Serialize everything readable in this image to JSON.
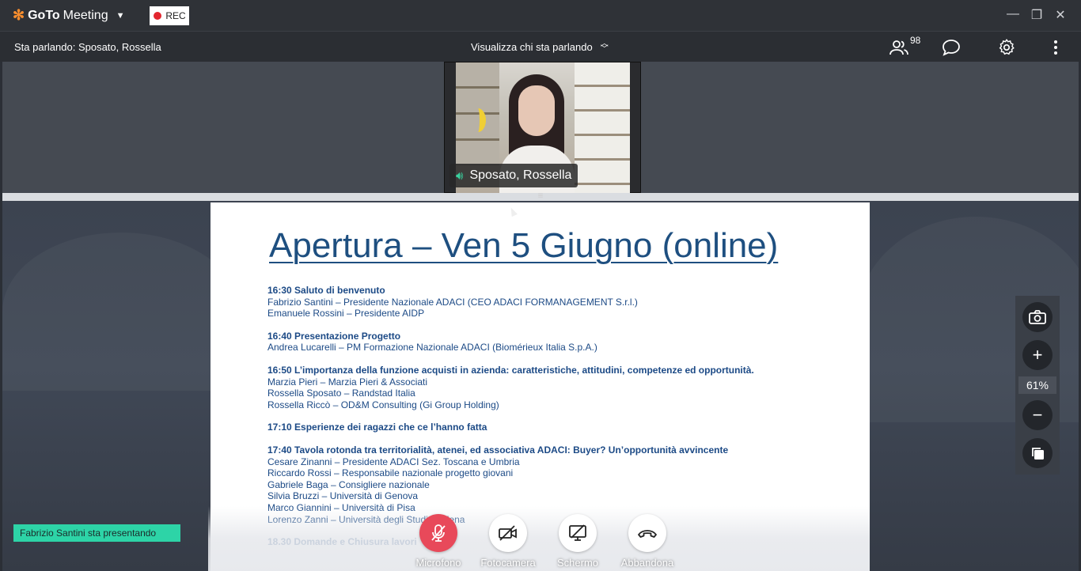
{
  "app": {
    "logo_brand": "GoTo",
    "logo_product": "Meeting",
    "rec_label": "REC"
  },
  "window_controls": {
    "minimize_icon": "minimize-icon",
    "restore_icon": "restore-icon",
    "close_icon": "close-icon"
  },
  "toolbar": {
    "speaking_label": "Sta parlando: Sposato,  Rossella",
    "view_selector_label": "Visualizza chi sta parlando",
    "attendee_count": "98"
  },
  "video": {
    "participant_name": "Sposato,  Rossella"
  },
  "slide": {
    "title": "Apertura – Ven 5 Giugno (online)",
    "agenda": [
      {
        "heading": "16:30 Saluto di benvenuto",
        "lines": [
          "Fabrizio Santini – Presidente Nazionale ADACI (CEO ADACI FORMANAGEMENT S.r.l.)",
          "Emanuele Rossini – Presidente AIDP"
        ]
      },
      {
        "heading": "16:40 Presentazione Progetto",
        "lines": [
          "Andrea Lucarelli – PM Formazione Nazionale ADACI (Biomérieux Italia S.p.A.)"
        ]
      },
      {
        "heading": "16:50   L’importanza della funzione acquisti in azienda: caratteristiche, attitudini, competenze ed opportunità.",
        "lines": [
          "Marzia Pieri – Marzia Pieri & Associati",
          "Rossella Sposato – Randstad Italia",
          "Rossella Riccò – OD&M Consulting (Gi Group Holding)"
        ]
      },
      {
        "heading": "17:10   Esperienze dei ragazzi che ce l’hanno fatta",
        "lines": []
      },
      {
        "heading": "17:40  Tavola rotonda tra territorialità, atenei, ed associativa ADACI: Buyer? Un’opportunità avvincente",
        "lines": [
          "Cesare Zinanni – Presidente ADACI Sez. Toscana e Umbria",
          "Riccardo Rossi – Responsabile nazionale progetto giovani",
          "Gabriele Baga – Consigliere nazionale",
          "Silvia Bruzzi – Università di Genova",
          "Marco Giannini – Università di Pisa",
          "Lorenzo Zanni – Università degli Studi di Siena"
        ]
      },
      {
        "heading": "18.30   Domande e Chiusura lavori",
        "lines": []
      }
    ]
  },
  "zoom": {
    "percent": "61%"
  },
  "presenter_banner": "Fabrizio Santini sta presentando",
  "controls": {
    "mic_label": "Microfono",
    "camera_label": "Fotocamera",
    "screen_label": "Schermo",
    "leave_label": "Abbandona"
  },
  "colors": {
    "accent_green": "#2dd4a7",
    "mic_red": "#e8495a",
    "slide_blue": "#1e4f80",
    "logo_orange": "#f68d2e"
  }
}
